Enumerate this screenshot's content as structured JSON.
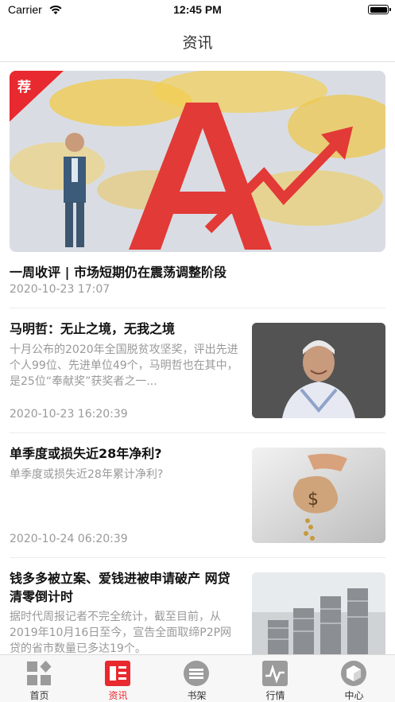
{
  "status_bar": {
    "carrier": "Carrier",
    "time": "12:45 PM"
  },
  "nav": {
    "title": "资讯"
  },
  "featured": {
    "badge": "荐",
    "title": "一周收评 | 市场短期仍在震荡调整阶段",
    "time": "2020-10-23 17:07"
  },
  "articles": [
    {
      "title": "马明哲：无止之境，无我之境",
      "summary": "十月公布的2020年全国脱贫攻坚奖，评出先进个人99位、先进单位49个，马明哲也在其中，是25位“奉献奖”获奖者之一...",
      "time": "2020-10-23 16:20:39"
    },
    {
      "title": "单季度或损失近28年净利?",
      "summary": "单季度或损失近28年累计净利?",
      "time": "2020-10-24 06:20:39"
    },
    {
      "title": "钱多多被立案、爱钱进被申请破产 网贷清零倒计时",
      "summary": "据时代周报记者不完全统计，截至目前，从2019年10月16日至今，宣告全面取缔P2P网贷的省市数量已多达19个。",
      "time": ""
    }
  ],
  "tabs": [
    {
      "label": "首页",
      "icon": "home-grid-icon"
    },
    {
      "label": "资讯",
      "icon": "news-icon"
    },
    {
      "label": "书架",
      "icon": "bookshelf-icon"
    },
    {
      "label": "行情",
      "icon": "market-chart-icon"
    },
    {
      "label": "中心",
      "icon": "user-center-icon"
    }
  ],
  "colors": {
    "accent": "#e8292f",
    "muted_text": "#999999",
    "tab_inactive": "#9b9b9b"
  }
}
